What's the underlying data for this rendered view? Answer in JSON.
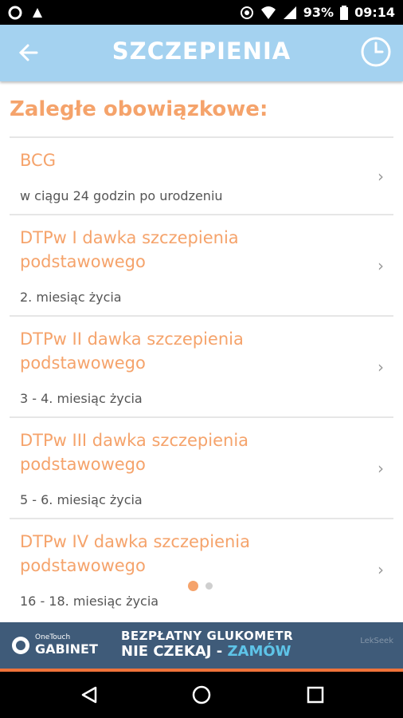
{
  "status": {
    "battery": "93%",
    "time": "09:14"
  },
  "appbar": {
    "title": "SZCZEPIENIA"
  },
  "section_title": "Zaległe obowiązkowe:",
  "items": [
    {
      "title": "BCG",
      "subtitle": "w ciągu 24 godzin po urodzeniu"
    },
    {
      "title": "DTPw I dawka szczepienia podstawowego",
      "subtitle": "2. miesiąc życia"
    },
    {
      "title": "DTPw II dawka szczepienia podstawowego",
      "subtitle": "3 - 4. miesiąc życia"
    },
    {
      "title": "DTPw III dawka szczepienia podstawowego",
      "subtitle": "5 - 6. miesiąc życia"
    },
    {
      "title": "DTPw IV dawka szczepienia podstawowego",
      "subtitle": "16 - 18. miesiąc życia"
    }
  ],
  "chevron": "›",
  "ad": {
    "brand_small": "OneTouch",
    "brand_big": "GABINET",
    "line1_a": "BEZPŁATNY ",
    "line1_b": "GLUKOMETR",
    "line2_a": "NIE CZEKAJ - ",
    "line2_b": "ZAMÓW",
    "right": "LekSeek"
  },
  "colors": {
    "appbar": "#a4d2f0",
    "accent": "#f5a36b",
    "ad_bg": "#3f5b79"
  }
}
